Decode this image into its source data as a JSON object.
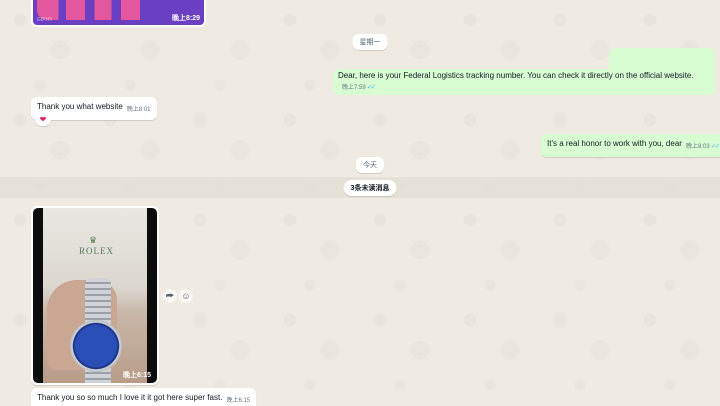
{
  "chat": {
    "top_image": {
      "watermark": "GIPHY",
      "time": "晚上8:29"
    },
    "date_monday": "星期一",
    "msg_tracking": {
      "text": "Dear, here is your Federal Logistics tracking number. You can check it directly on the official website.",
      "time": "晚上7:59",
      "ticks": "✓✓"
    },
    "msg_website": {
      "text": "Thank you what website",
      "time": "晚上8:01",
      "reaction": "❤"
    },
    "msg_honor": {
      "text": "It's a real honor to work with you, dear",
      "time": "晚上8:03",
      "ticks": "✓✓"
    },
    "date_today": "今天",
    "unread": "3条未读消息",
    "video": {
      "brand": "ROLEX",
      "crown": "♛",
      "time": "晚上6:15"
    },
    "actions": {
      "forward_icon": "⮫",
      "emoji_icon": "☺"
    },
    "msg_thanks": {
      "text": "Thank you so so much I love it it got here super fast.",
      "time": "晚上6:15"
    }
  }
}
